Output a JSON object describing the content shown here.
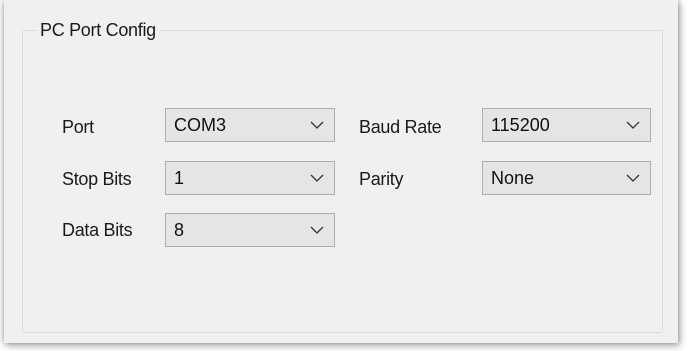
{
  "group": {
    "title": "PC Port Config"
  },
  "fields": {
    "port": {
      "label": "Port",
      "value": "COM3"
    },
    "baud_rate": {
      "label": "Baud Rate",
      "value": "115200"
    },
    "stop_bits": {
      "label": "Stop Bits",
      "value": "1"
    },
    "parity": {
      "label": "Parity",
      "value": "None"
    },
    "data_bits": {
      "label": "Data Bits",
      "value": "8"
    }
  },
  "icons": {
    "dropdown": "chevron-down-icon"
  }
}
